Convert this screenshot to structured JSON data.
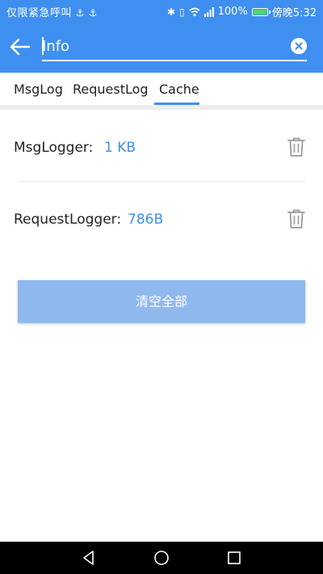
{
  "status_bar": {
    "carrier_text": "仅限紧急呼叫",
    "left_icons": [
      "usb-icon",
      "usb-icon"
    ],
    "right_icons": [
      "bluetooth-icon",
      "vibrate-icon",
      "wifi-icon",
      "signal-icon"
    ],
    "battery": "100%",
    "time": "傍晚5:32"
  },
  "header": {
    "search_value": "Info",
    "background": "#3f8ff0"
  },
  "tabs": [
    {
      "label": "MsgLog",
      "selected": false
    },
    {
      "label": "RequestLog",
      "selected": false
    },
    {
      "label": "Cache",
      "selected": true
    }
  ],
  "cache_items": [
    {
      "label": "MsgLogger:",
      "value": "1 KB"
    },
    {
      "label": "RequestLogger:",
      "value": "786B"
    }
  ],
  "clear_all_label": "清空全部",
  "colors": {
    "accent": "#3f8ff0",
    "button": "#8fb9ee"
  }
}
